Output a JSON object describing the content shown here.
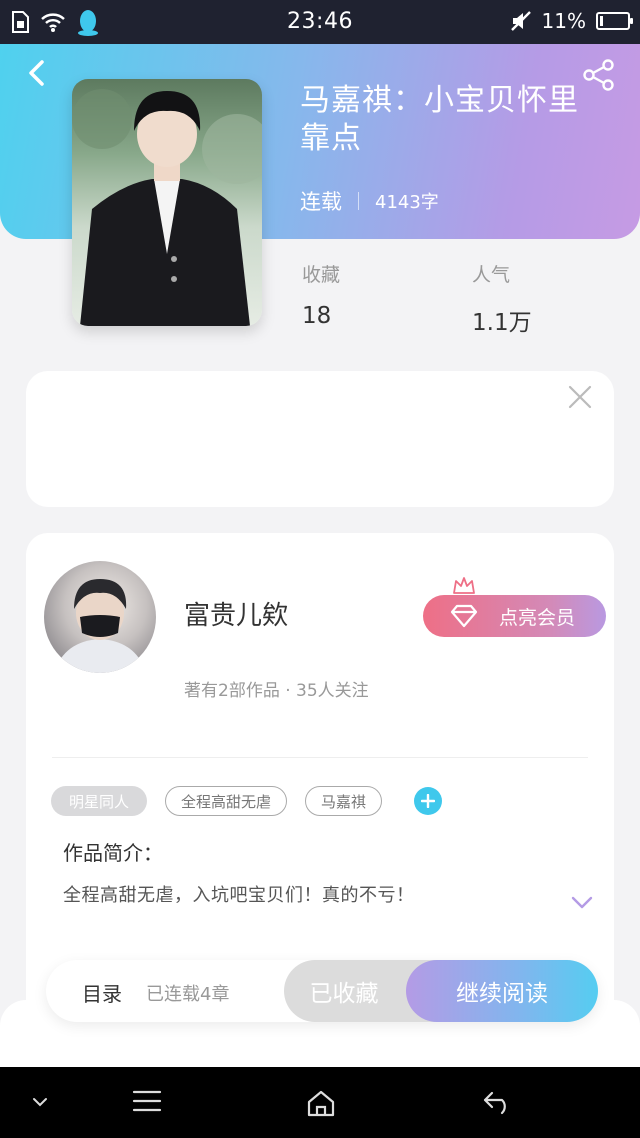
{
  "status_bar": {
    "time": "23:46",
    "battery": "11%",
    "battery_level": 0.11
  },
  "book": {
    "title": "马嘉祺：小宝贝怀里靠点",
    "status": "连载",
    "word_count": "4143字",
    "favorites_label": "收藏",
    "favorites_value": "18",
    "popularity_label": "人气",
    "popularity_value": "1.1万"
  },
  "author": {
    "name": "富贵儿欸",
    "meta": "著有2部作品 · 35人关注",
    "vip_label": "点亮会员"
  },
  "tags": [
    {
      "label": "明星同人"
    },
    {
      "label": "全程高甜无虐"
    },
    {
      "label": "马嘉祺"
    }
  ],
  "intro": {
    "label": "作品简介：",
    "text": "全程高甜无虐，入坑吧宝贝们！真的不亏！"
  },
  "action_bar": {
    "toc_label": "目录",
    "toc_info": "已连载4章",
    "collected_label": "已收藏",
    "read_label": "继续阅读"
  },
  "colors": {
    "header_gradient_start": "#4fd1ee",
    "header_gradient_end": "#c69be4",
    "accent_blue": "#3fc8ec",
    "vip_pink": "#ee6f86"
  }
}
